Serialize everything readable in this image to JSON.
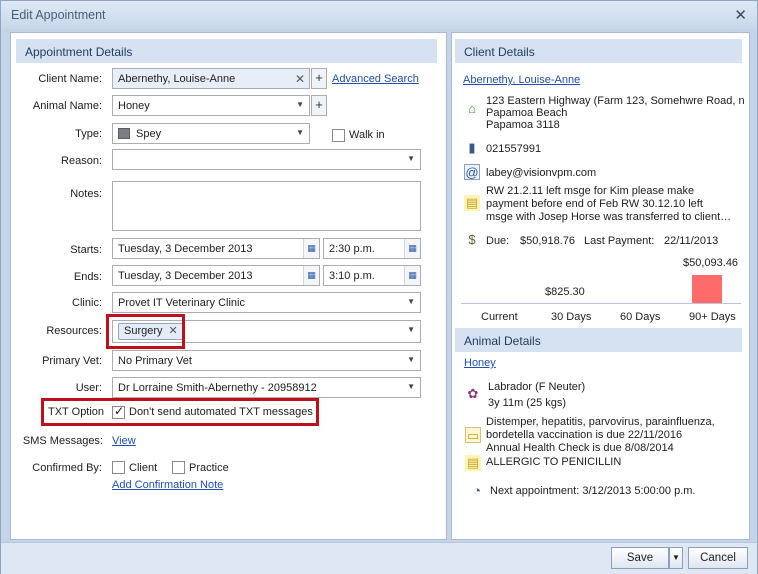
{
  "window": {
    "title": "Edit Appointment",
    "close_glyph": "✕"
  },
  "appointment": {
    "header": "Appointment Details",
    "client_name": {
      "label": "Client Name:",
      "value": "Abernethy, Louise-Anne",
      "advanced_search": "Advanced Search"
    },
    "animal_name": {
      "label": "Animal Name:",
      "value": "Honey"
    },
    "type": {
      "label": "Type:",
      "value": "Spey",
      "swatch_color": "#7b7e84",
      "walk_in_label": "Walk in",
      "walk_in_checked": false
    },
    "reason": {
      "label": "Reason:",
      "value": ""
    },
    "notes": {
      "label": "Notes:",
      "value": ""
    },
    "starts": {
      "label": "Starts:",
      "date": "Tuesday, 3 December 2013",
      "time": "2:30 p.m."
    },
    "ends": {
      "label": "Ends:",
      "date": "Tuesday, 3 December 2013",
      "time": "3:10 p.m."
    },
    "clinic": {
      "label": "Clinic:",
      "value": "Provet IT Veterinary Clinic"
    },
    "resources": {
      "label": "Resources:",
      "tag": "Surgery"
    },
    "primary_vet": {
      "label": "Primary Vet:",
      "value": "No Primary Vet"
    },
    "user": {
      "label": "User:",
      "value": "Dr Lorraine Smith-Abernethy - 20958912"
    },
    "txt_option": {
      "label": "TXT Option",
      "checkbox_label": "Don't send automated TXT messages",
      "checked": true
    },
    "sms": {
      "label": "SMS Messages:",
      "link": "View"
    },
    "confirmed_by": {
      "label": "Confirmed By:",
      "client_label": "Client",
      "practice_label": "Practice",
      "add_note_link": "Add Confirmation Note"
    }
  },
  "client_details": {
    "header": "Client Details",
    "name_link": "Abernethy, Louise-Anne",
    "address_line1": "123 Eastern Highway (Farm 123, Somehwre Road, n",
    "address_line2": "Papamoa Beach",
    "address_line3": "Papamoa  3118",
    "phone": "021557991",
    "email": "labey@visionvpm.com",
    "note_line1": "RW 21.2.11 left msge for Kim please make",
    "note_line2": "payment before end of Feb RW 30.12.10 left",
    "note_line3": "msge with Josep Horse was transferred to client…",
    "due_label": "Due:",
    "due_value": "$50,918.76",
    "last_payment_label": "Last Payment:",
    "last_payment_value": "22/11/2013"
  },
  "chart_data": {
    "type": "bar",
    "categories": [
      "Current",
      "30 Days",
      "60 Days",
      "90+ Days"
    ],
    "values": [
      0,
      825.3,
      0,
      50093.46
    ],
    "data_labels": [
      "",
      "$825.30",
      "",
      "$50,093.46"
    ],
    "bar_color": "#ff6b6b",
    "ylim": [
      0,
      50093.46
    ]
  },
  "animal_details": {
    "header": "Animal Details",
    "name_link": "Honey",
    "breed": "Labrador    (F Neuter)",
    "age_weight": "3y 11m    (25 kgs)",
    "reminder_line1": "Distemper, hepatitis, parvovirus, parainfluenza,",
    "reminder_line2": "bordetella vaccination is due 22/11/2016",
    "reminder_line3": "Annual Health Check is due 8/08/2014",
    "alert": "ALLERGIC TO PENICILLIN",
    "next_appointment": "Next appointment: 3/12/2013 5:00:00 p.m."
  },
  "footer": {
    "save_label": "Save",
    "cancel_label": "Cancel"
  },
  "icons": {
    "dropdown": "▼",
    "clear": "✕",
    "plus": "+",
    "calendar": "▦",
    "home": "⌂",
    "phone": "▮",
    "email": "@",
    "note": "▤",
    "money": "$",
    "dog": "✿",
    "reminder": "▭",
    "alert": "▤",
    "appointment": "◔"
  }
}
